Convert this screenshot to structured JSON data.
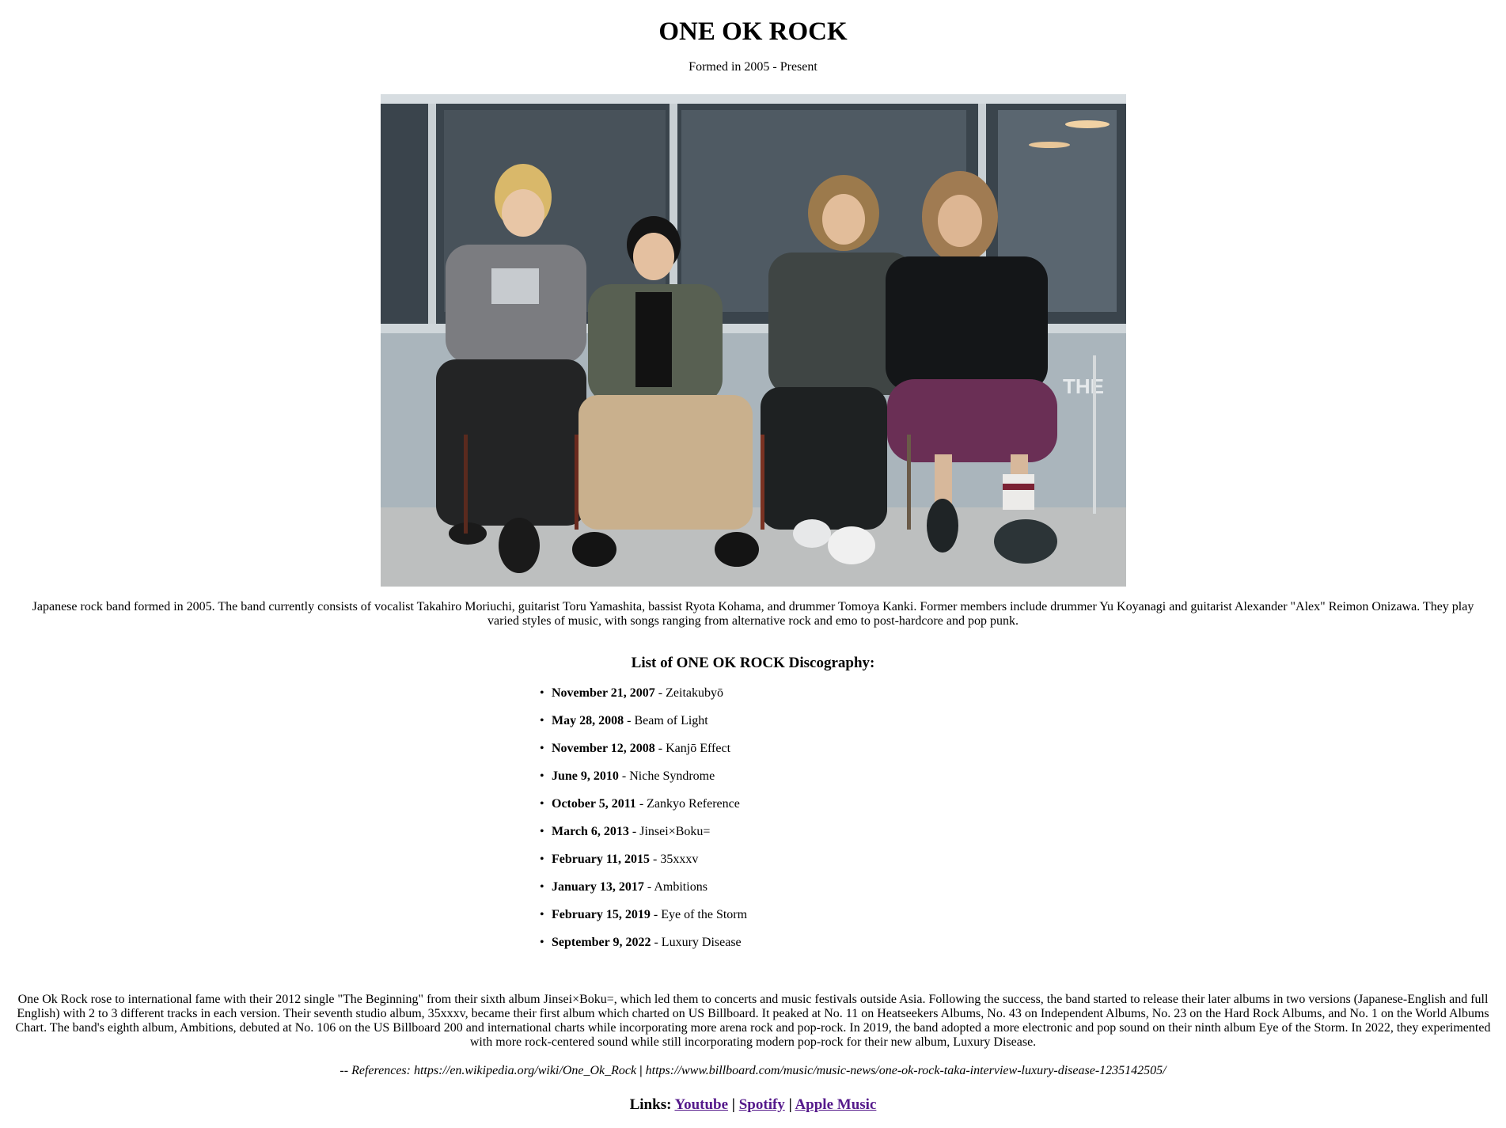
{
  "page": {
    "title": "ONE OK ROCK",
    "subtitle": "Formed in 2005 - Present"
  },
  "photo": {
    "icon": "band-photo"
  },
  "intro": "Japanese rock band formed in 2005. The band currently consists of vocalist Takahiro Moriuchi, guitarist Toru Yamashita, bassist Ryota Kohama, and drummer Tomoya Kanki. Former members include drummer Yu Koyanagi and guitarist Alexander \"Alex\" Reimon Onizawa. They play varied styles of music, with songs ranging from alternative rock and emo to post-hardcore and pop punk.",
  "discography": {
    "heading": "List of ONE OK ROCK Discography:",
    "items": [
      {
        "date": "November 21, 2007",
        "album": " - Zeitakubyō"
      },
      {
        "date": "May 28, 2008",
        "album": " - Beam of Light"
      },
      {
        "date": "November 12, 2008",
        "album": " - Kanjō Effect"
      },
      {
        "date": "June 9, 2010",
        "album": " - Niche Syndrome"
      },
      {
        "date": "October 5, 2011",
        "album": " - Zankyo Reference"
      },
      {
        "date": "March 6, 2013",
        "album": " - Jinsei×Boku="
      },
      {
        "date": "February 11, 2015",
        "album": " - 35xxxv"
      },
      {
        "date": "January 13, 2017",
        "album": " - Ambitions"
      },
      {
        "date": "February 15, 2019",
        "album": " - Eye of the Storm"
      },
      {
        "date": "September 9, 2022",
        "album": " - Luxury Disease"
      }
    ]
  },
  "history": "One Ok Rock rose to international fame with their 2012 single \"The Beginning\" from their sixth album Jinsei×Boku=, which led them to concerts and music festivals outside Asia. Following the success, the band started to release their later albums in two versions (Japanese-English and full English) with 2 to 3 different tracks in each version. Their seventh studio album, 35xxxv, became their first album which charted on US Billboard. It peaked at No. 11 on Heatseekers Albums, No. 43 on Independent Albums, No. 23 on the Hard Rock Albums, and No. 1 on the World Albums Chart. The band's eighth album, Ambitions, debuted at No. 106 on the US Billboard 200 and international charts while incorporating more arena rock and pop-rock. In 2019, the band adopted a more electronic and pop sound on their ninth album Eye of the Storm. In 2022, they experimented with more rock-centered sound while still incorporating modern pop-rock for their new album, Luxury Disease.",
  "references": {
    "prefix": "-- References: https://en.wikipedia.org/wiki/One_Ok_Rock",
    "separator": "|",
    "second": "https://www.billboard.com/music/music-news/one-ok-rock-taka-interview-luxury-disease-1235142505/"
  },
  "links": {
    "label": "Links:",
    "separator": "|",
    "youtube": "Youtube",
    "spotify": "Spotify",
    "apple": "Apple Music"
  },
  "colors": {
    "link_visited": "#551a8b",
    "text": "#000000"
  }
}
